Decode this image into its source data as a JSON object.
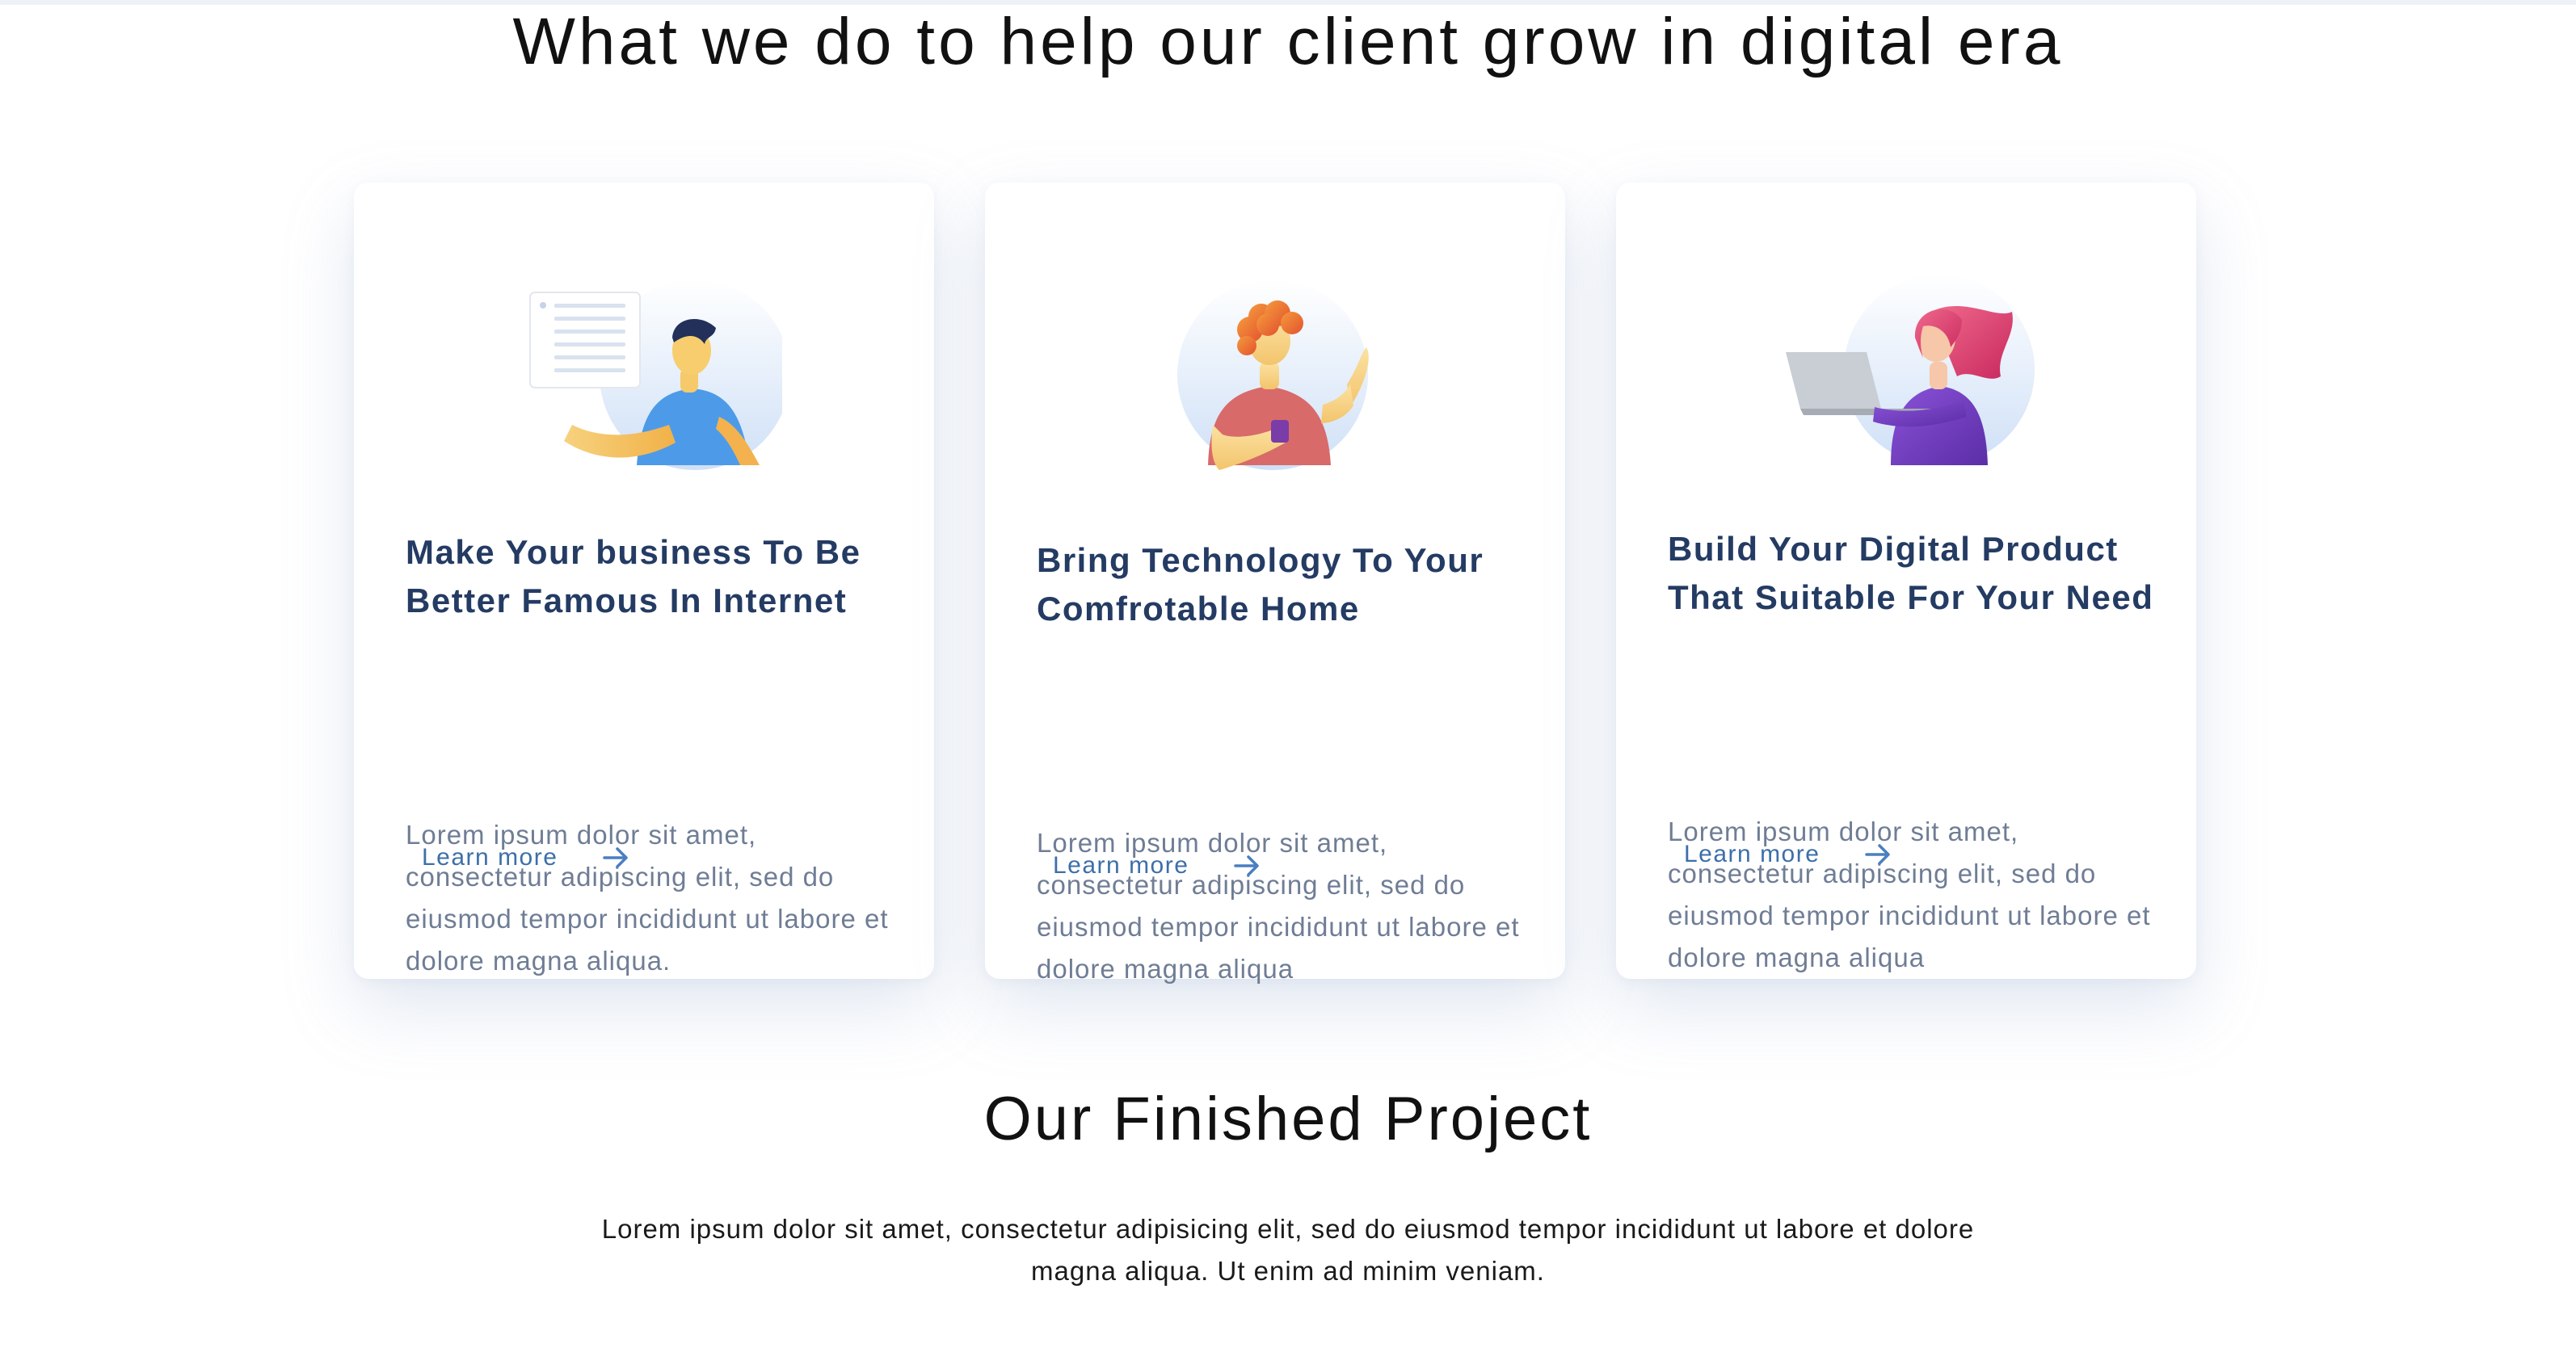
{
  "services": {
    "title": "What we do to help our client grow in digital era",
    "cards": [
      {
        "title": "Make Your business To Be Better Famous In Internet",
        "text": "Lorem ipsum dolor sit amet, consectetur adipiscing elit, sed do eiusmod tempor incididunt ut labore et dolore magna aliqua.",
        "link_label": "Learn more",
        "illustration": "man-holding-document-icon"
      },
      {
        "title": "Bring Technology To Your Comfrotable Home",
        "text": "Lorem ipsum dolor sit amet, consectetur adipiscing elit, sed do eiusmod tempor incididunt ut labore et dolore magna aliqua",
        "link_label": "Learn more",
        "illustration": "man-with-phone-icon"
      },
      {
        "title": "Build Your Digital Product That Suitable For Your Need",
        "text": "Lorem ipsum dolor sit amet, consectetur adipiscing elit, sed do eiusmod tempor incididunt ut labore et dolore magna aliqua",
        "link_label": "Learn more",
        "illustration": "woman-with-laptop-icon"
      }
    ]
  },
  "projects": {
    "title": "Our Finished Project",
    "description": "Lorem ipsum dolor sit amet, consectetur adipisicing elit, sed do eiusmod tempor incididunt ut labore et dolore magna aliqua. Ut enim ad minim veniam."
  },
  "colors": {
    "card_title": "#243b63",
    "body_text": "#6f7d95",
    "link": "#3d6fa8",
    "heading": "#111111"
  }
}
